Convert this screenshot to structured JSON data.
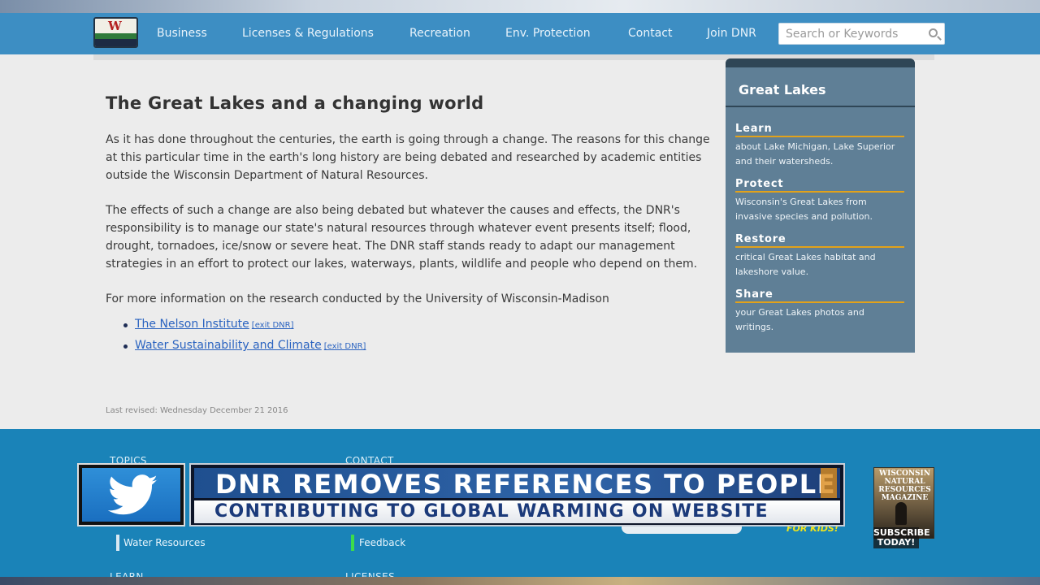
{
  "header": {
    "nav": [
      "Business",
      "Licenses & Regulations",
      "Recreation",
      "Env. Protection",
      "Contact",
      "Join DNR"
    ],
    "search_placeholder": "Search or Keywords"
  },
  "main": {
    "title": "The Great Lakes and a changing world",
    "paragraphs": [
      "As it has done throughout the centuries, the earth is going through a change. The reasons for this change at this particular time in the earth's long history are being debated and researched by academic entities outside the Wisconsin Department of Natural Resources.",
      "The effects of such a change are also being debated but whatever the causes and effects, the DNR's responsibility is to manage our state's natural resources through whatever event presents itself; flood, drought, tornadoes, ice/snow or severe heat. The DNR staff stands ready to adapt our management strategies in an effort to protect our lakes, waterways, plants, wildlife and people who depend on them.",
      "For more information on the research conducted by the University of Wisconsin-Madison"
    ],
    "links": [
      {
        "label": "The Nelson Institute",
        "exit": "[exit DNR]"
      },
      {
        "label": "Water Sustainability and Climate",
        "exit": "[exit DNR]"
      }
    ],
    "last_revised": "Last revised: Wednesday December 21 2016"
  },
  "sidebar": {
    "title": "Great Lakes",
    "sections": [
      {
        "heading": "Learn",
        "text": "about Lake Michigan, Lake Superior and their watersheds."
      },
      {
        "heading": "Protect",
        "text": "Wisconsin's Great Lakes from invasive species and pollution."
      },
      {
        "heading": "Restore",
        "text": "critical Great Lakes habitat and lakeshore value."
      },
      {
        "heading": "Share",
        "text": "your Great Lakes photos and writings."
      }
    ]
  },
  "footer": {
    "headings": [
      "TOPICS",
      "CONTACT",
      "LEARN",
      "LICENSES"
    ],
    "links": [
      "Water Resources",
      "Feedback"
    ],
    "for_kids": "FOR KIDS!"
  },
  "overlay": {
    "headline_top": "DNR REMOVES REFERENCES TO PEOPLE",
    "headline_bottom": "CONTRIBUTING TO GLOBAL WARMING ON WEBSITE",
    "magazine_title": "WISCONSIN NATURAL RESOURCES MAGAZINE",
    "subscribe": "SUBSCRIBE TODAY!"
  },
  "colors": {
    "header_blue": "#3d8ec3",
    "footer_blue": "#1a83b8",
    "sidebar_slate": "#5f7f96",
    "sidebar_accent": "#e2a21a",
    "link_blue": "#2a63c0"
  }
}
